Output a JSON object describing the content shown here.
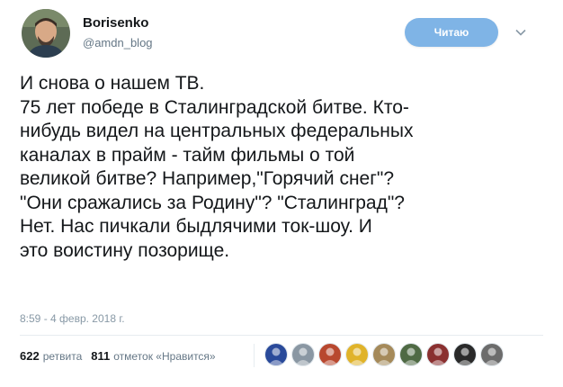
{
  "header": {
    "display_name": "Borisenko",
    "handle": "@amdn_blog",
    "follow_label": "Читаю"
  },
  "tweet": {
    "lines": [
      "И снова о нашем ТВ.",
      "75 лет победе в Сталинградской битве. Кто-",
      "нибудь видел на центральных федеральных",
      "каналах в прайм - тайм фильмы о той",
      "великой битве? Например,\"Горячий снег\"?",
      "\"Они сражались за Родину\"? \"Сталинград\"?",
      "Нет. Нас пичкали быдлячими ток-шоу. И",
      "это воистину позорище."
    ],
    "timestamp": "8:59 - 4 февр. 2018 г."
  },
  "stats": {
    "retweets_count": "622",
    "retweets_label": "ретвита",
    "likes_count": "811",
    "likes_label": "отметок «Нравится»"
  },
  "likers": [
    {
      "icon": "flag-avatar-icon",
      "color": "#2a4a9a"
    },
    {
      "icon": "default-avatar-icon",
      "color": "#8a97a3"
    },
    {
      "icon": "emblem-avatar-icon",
      "color": "#b8482f"
    },
    {
      "icon": "batman-avatar-icon",
      "color": "#e0b32a"
    },
    {
      "icon": "photo-avatar-icon",
      "color": "#a58a5a"
    },
    {
      "icon": "photo-avatar-icon",
      "color": "#4f6a44"
    },
    {
      "icon": "photo-avatar-icon",
      "color": "#8a3030"
    },
    {
      "icon": "dark-avatar-icon",
      "color": "#2a2a2a"
    },
    {
      "icon": "photo-avatar-icon",
      "color": "#6c6c6c"
    }
  ]
}
